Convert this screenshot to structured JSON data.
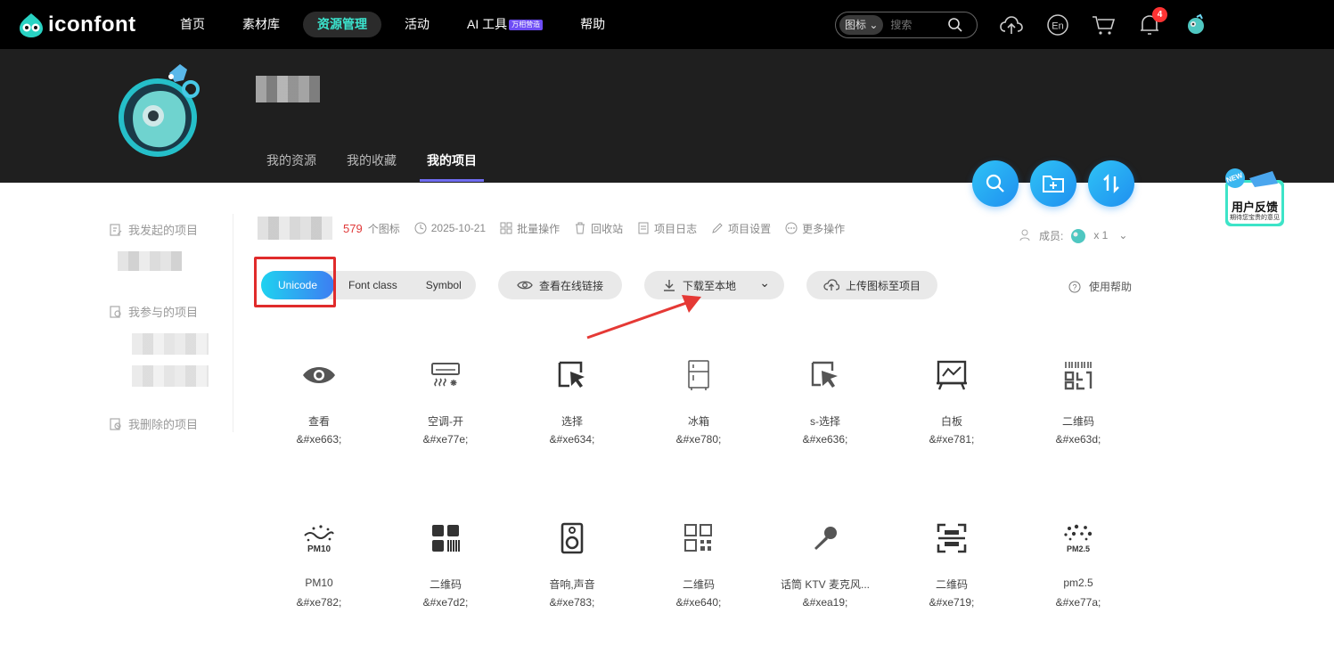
{
  "topbar": {
    "logo_text": "iconfont",
    "nav": [
      "首页",
      "素材库",
      "资源管理",
      "活动",
      "AI 工具",
      "帮助"
    ],
    "active_nav": "资源管理",
    "ai_badge": "万相营造",
    "search": {
      "type": "图标",
      "placeholder": "搜索"
    },
    "notification_count": "4"
  },
  "hero": {
    "tabs": [
      "我的资源",
      "我的收藏",
      "我的项目"
    ],
    "active_tab": "我的项目"
  },
  "sidebar": {
    "sections": [
      "我发起的项目",
      "我参与的项目",
      "我删除的项目"
    ]
  },
  "project": {
    "icon_count": "579",
    "icon_count_unit": "个图标",
    "date": "2025-10-21",
    "actions": [
      "批量操作",
      "回收站",
      "项目日志",
      "项目设置",
      "更多操作"
    ],
    "members_label": "成员:",
    "members_count": "x 1"
  },
  "toolbar": {
    "tabs": [
      "Unicode",
      "Font class",
      "Symbol"
    ],
    "active_tab": "Unicode",
    "view_link": "查看在线链接",
    "download": "下载至本地",
    "upload": "上传图标至项目",
    "help": "使用帮助"
  },
  "feedback": {
    "label": "用户反馈",
    "sub": "期待您宝贵的意见",
    "new": "NEW"
  },
  "icons": [
    {
      "name": "查看",
      "code": "&#xe663;",
      "glyph": "eye-icon"
    },
    {
      "name": "空调-开",
      "code": "&#xe77e;",
      "glyph": "air-conditioner-icon"
    },
    {
      "name": "选择",
      "code": "&#xe634;",
      "glyph": "select-cursor-icon"
    },
    {
      "name": "冰箱",
      "code": "&#xe780;",
      "glyph": "fridge-icon"
    },
    {
      "name": "s-选择",
      "code": "&#xe636;",
      "glyph": "s-select-icon"
    },
    {
      "name": "白板",
      "code": "&#xe781;",
      "glyph": "whiteboard-icon"
    },
    {
      "name": "二维码",
      "code": "&#xe63d;",
      "glyph": "qrcode-scan-icon"
    },
    {
      "name": "PM10",
      "code": "&#xe782;",
      "glyph": "pm10-icon"
    },
    {
      "name": "二维码",
      "code": "&#xe7d2;",
      "glyph": "qrcode-icon"
    },
    {
      "name": "音响,声音",
      "code": "&#xe783;",
      "glyph": "speaker-icon"
    },
    {
      "name": "二维码",
      "code": "&#xe640;",
      "glyph": "qrcode-grid-icon"
    },
    {
      "name": "话筒 KTV 麦克风...",
      "code": "&#xea19;",
      "glyph": "microphone-icon"
    },
    {
      "name": "二维码",
      "code": "&#xe719;",
      "glyph": "qrcode-frame-icon"
    },
    {
      "name": "pm2.5",
      "code": "&#xe77a;",
      "glyph": "pm25-icon"
    }
  ]
}
